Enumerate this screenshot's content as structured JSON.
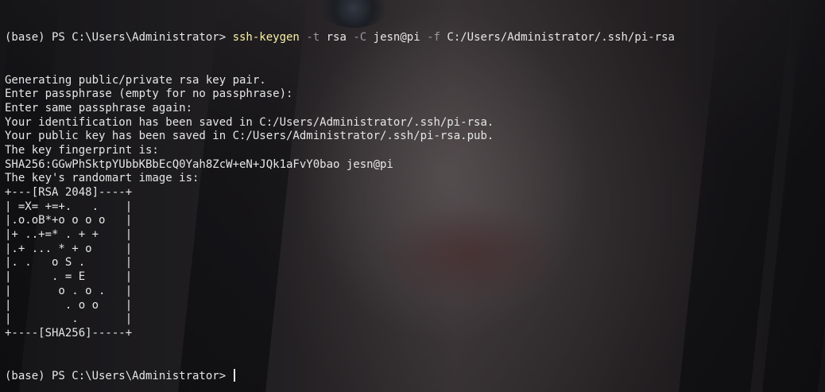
{
  "terminal": {
    "prompt": "(base) PS C:\\Users\\Administrator> ",
    "command": {
      "name": "ssh-keygen",
      "tokens": [
        {
          "kind": "space",
          "text": " "
        },
        {
          "kind": "flag",
          "text": "-t"
        },
        {
          "kind": "space",
          "text": " "
        },
        {
          "kind": "arg",
          "text": "rsa"
        },
        {
          "kind": "space",
          "text": " "
        },
        {
          "kind": "flag",
          "text": "-C"
        },
        {
          "kind": "space",
          "text": " "
        },
        {
          "kind": "arg",
          "text": "jesn@pi"
        },
        {
          "kind": "space",
          "text": " "
        },
        {
          "kind": "flag",
          "text": "-f"
        },
        {
          "kind": "space",
          "text": " "
        },
        {
          "kind": "arg",
          "text": "C:/Users/Administrator/.ssh/pi-rsa"
        }
      ]
    },
    "output_lines": [
      "Generating public/private rsa key pair.",
      "Enter passphrase (empty for no passphrase):",
      "Enter same passphrase again:",
      "Your identification has been saved in C:/Users/Administrator/.ssh/pi-rsa.",
      "Your public key has been saved in C:/Users/Administrator/.ssh/pi-rsa.pub.",
      "The key fingerprint is:",
      "SHA256:GGwPhSktpYUbbKBbEcQ0Yah8ZcW+eN+JQk1aFvY0bao jesn@pi",
      "The key's randomart image is:",
      "+---[RSA 2048]----+",
      "| =X= +=+.   .    |",
      "|.o.oB*+o o o o   |",
      "|+ ..+=* . + +    |",
      "|.+ ... * + o     |",
      "|. .   o S .      |",
      "|      . = E      |",
      "|       o . o .   |",
      "|        . o o    |",
      "|         .       |",
      "+----[SHA256]-----+"
    ],
    "final_prompt": "(base) PS C:\\Users\\Administrator> "
  }
}
